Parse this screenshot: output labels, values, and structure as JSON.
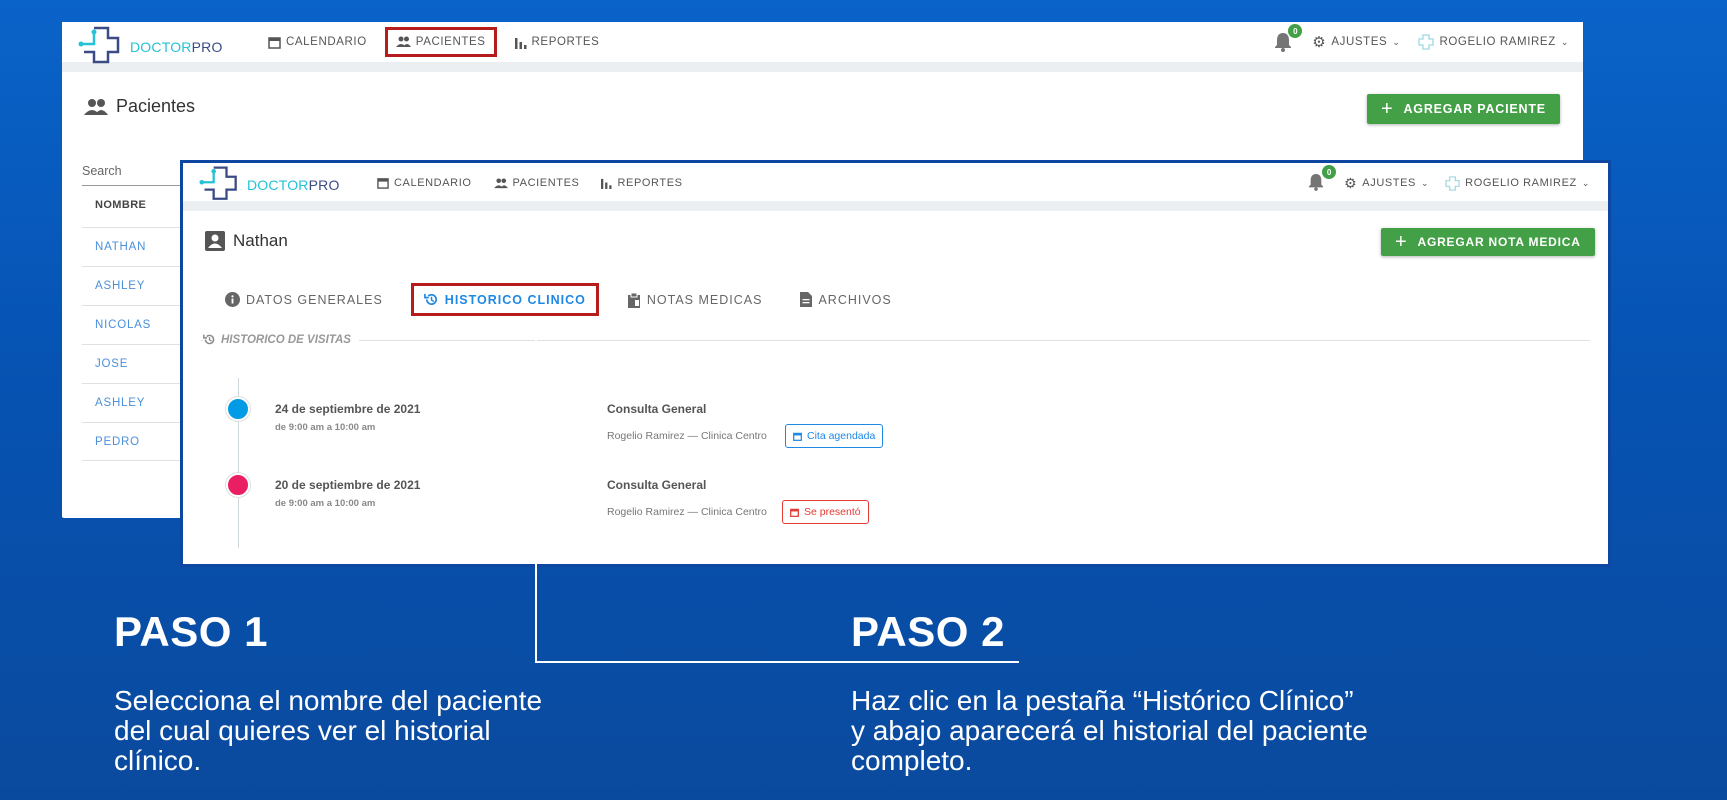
{
  "app": {
    "logo_part1": "DOCTOR",
    "logo_part2": "PRO",
    "nav": {
      "calendar": "CALENDARIO",
      "patients": "PACIENTES",
      "reports": "REPORTES"
    },
    "notifications_count": "0",
    "settings": "AJUSTES",
    "user": "ROGELIO RAMIREZ"
  },
  "patients_window": {
    "page_title": "Pacientes",
    "add_button": "AGREGAR PACIENTE",
    "search_label": "Search",
    "column_header": "NOMBRE",
    "patients": [
      "NATHAN",
      "ASHLEY",
      "NICOLAS",
      "JOSE",
      "ASHLEY",
      "PEDRO"
    ]
  },
  "patient_window": {
    "patient_name": "Nathan",
    "add_note_button": "AGREGAR NOTA MEDICA",
    "tabs": {
      "general": "DATOS GENERALES",
      "history": "HISTORICO CLINICO",
      "notes": "NOTAS MEDICAS",
      "files": "ARCHIVOS"
    },
    "section_label": "HISTORICO DE VISITAS",
    "events": [
      {
        "date": "24 de septiembre de 2021",
        "time": "de 9:00 am a 10:00 am",
        "title": "Consulta General",
        "meta": "Rogelio Ramirez  —  Clinica Centro",
        "status": "Cita agendada",
        "dot_color": "#039be5"
      },
      {
        "date": "20 de septiembre de 2021",
        "time": "de 9:00 am a 10:00 am",
        "title": "Consulta General",
        "meta": "Rogelio Ramirez — Clinica Centro",
        "status": "Se presentó",
        "dot_color": "#e91e63"
      }
    ]
  },
  "steps": {
    "step1_title": "PASO 1",
    "step1_line1": "Selecciona el nombre del paciente",
    "step1_line2": "del cual quieres ver el historial",
    "step1_line3": "clínico.",
    "step2_title": "PASO 2",
    "step2_line1": "Haz clic en la pestaña “Histórico Clínico”",
    "step2_line2": "y abajo aparecerá el historial del paciente",
    "step2_line3": "completo."
  },
  "colors": {
    "accent_green": "#43a047",
    "highlight_red": "#b71c1c",
    "link_blue": "#1e88e5"
  }
}
